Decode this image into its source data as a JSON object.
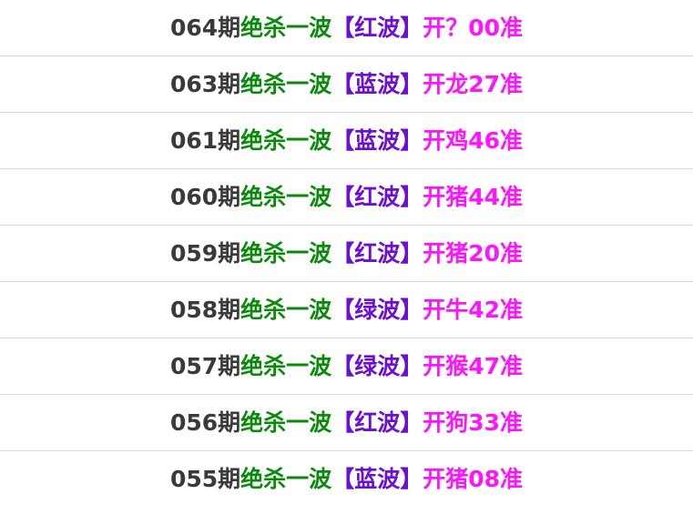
{
  "colors": {
    "period": "#3a3a3a",
    "kill": "#0a8a0a",
    "wave": "#6b0fd6",
    "result": "#ff14ff",
    "divider": "#d9d9d9"
  },
  "rows": [
    {
      "period": "064期",
      "kill": "绝杀一波",
      "wave": "【红波】",
      "result": "开？00准"
    },
    {
      "period": "063期",
      "kill": "绝杀一波",
      "wave": "【蓝波】",
      "result": "开龙27准"
    },
    {
      "period": "061期",
      "kill": "绝杀一波",
      "wave": "【蓝波】",
      "result": "开鸡46准"
    },
    {
      "period": "060期",
      "kill": "绝杀一波",
      "wave": "【红波】",
      "result": "开猪44准"
    },
    {
      "period": "059期",
      "kill": "绝杀一波",
      "wave": "【红波】",
      "result": "开猪20准"
    },
    {
      "period": "058期",
      "kill": "绝杀一波",
      "wave": "【绿波】",
      "result": "开牛42准"
    },
    {
      "period": "057期",
      "kill": "绝杀一波",
      "wave": "【绿波】",
      "result": "开猴47准"
    },
    {
      "period": "056期",
      "kill": "绝杀一波",
      "wave": "【红波】",
      "result": "开狗33准"
    },
    {
      "period": "055期",
      "kill": "绝杀一波",
      "wave": "【蓝波】",
      "result": "开猪08准"
    }
  ]
}
